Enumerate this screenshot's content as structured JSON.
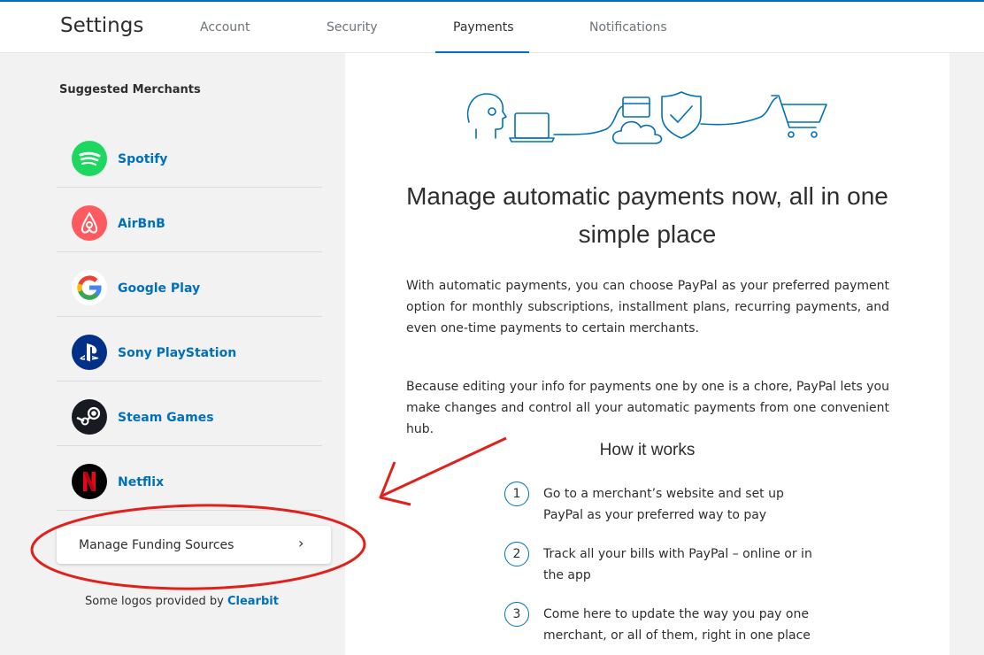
{
  "header": {
    "title": "Settings",
    "tabs": [
      {
        "label": "Account",
        "active": false
      },
      {
        "label": "Security",
        "active": false
      },
      {
        "label": "Payments",
        "active": true
      },
      {
        "label": "Notifications",
        "active": false
      }
    ]
  },
  "sidebar": {
    "heading": "Suggested Merchants",
    "merchants": [
      {
        "name": "Spotify",
        "icon": "spotify-logo",
        "color": "#1ed760"
      },
      {
        "name": "AirBnB",
        "icon": "airbnb-logo",
        "color": "#ff5a5f"
      },
      {
        "name": "Google Play",
        "icon": "google-logo",
        "color": "#ffffff"
      },
      {
        "name": "Sony PlayStation",
        "icon": "playstation-logo",
        "color": "#003087"
      },
      {
        "name": "Steam Games",
        "icon": "steam-logo",
        "color": "#171a21"
      },
      {
        "name": "Netflix",
        "icon": "netflix-logo",
        "color": "#000000"
      }
    ],
    "funding_label": "Manage Funding Sources",
    "credits_prefix": "Some logos provided by",
    "credits_link": "Clearbit"
  },
  "main": {
    "headline": "Manage automatic payments now, all in one simple place",
    "para1": "With automatic payments, you can choose PayPal as your preferred payment option for monthly subscriptions, installment plans, recurring payments, and even one-time payments to certain merchants.",
    "para2": "Because editing your info for payments one by one is a chore, PayPal lets you make changes and control all your automatic payments from one convenient hub.",
    "how_title": "How it works",
    "steps": [
      {
        "num": "1",
        "text": "Go to a merchant’s website and set up PayPal as your preferred way to pay"
      },
      {
        "num": "2",
        "text": "Track all your bills with PayPal – online or in the app"
      },
      {
        "num": "3",
        "text": "Come here to update the way you pay one merchant, or all of them, right in one place"
      }
    ]
  },
  "colors": {
    "accent": "#0070ba",
    "annotation": "#e0201b"
  }
}
